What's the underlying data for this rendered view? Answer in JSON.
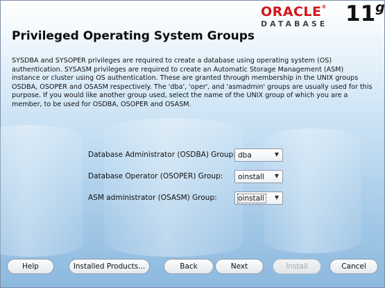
{
  "brand": {
    "company": "ORACLE",
    "product": "DATABASE",
    "version": "11",
    "version_suffix": "g"
  },
  "page": {
    "title": "Privileged Operating System Groups",
    "description": "SYSDBA and SYSOPER privileges are required to create a database using operating system (OS) authentication. SYSASM privileges are required to create an Automatic Storage Management (ASM) instance or cluster using OS authentication.  These are granted through membership in the UNIX groups OSDBA, OSOPER and OSASM respectively.  The 'dba', 'oper', and 'asmadmin' groups are usually used for this purpose. If you would like another group used, select the name of the UNIX group of which you are a member, to be used for OSDBA, OSOPER and OSASM."
  },
  "form": {
    "osdba": {
      "label": "Database Administrator (OSDBA) Group:",
      "value": "dba"
    },
    "osoper": {
      "label": "Database Operator (OSOPER) Group:",
      "value": "oinstall"
    },
    "osasm": {
      "label": "ASM administrator (OSASM) Group:",
      "value": "oinstall"
    }
  },
  "buttons": {
    "help": "Help",
    "installed_products": "Installed Products...",
    "back": "Back",
    "next": "Next",
    "install": "Install",
    "cancel": "Cancel"
  },
  "colors": {
    "brand_red": "#d4161b",
    "background_blue": "#bcd9f0",
    "disabled_text": "#a3a9b0"
  }
}
